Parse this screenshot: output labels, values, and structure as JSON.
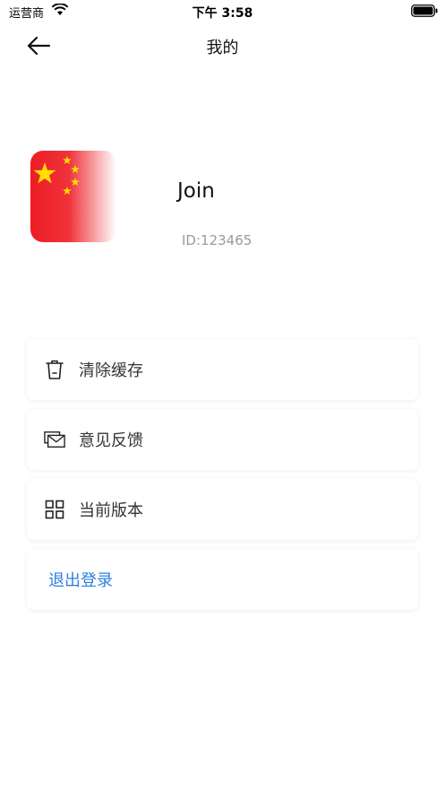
{
  "status_bar": {
    "carrier": "运营商",
    "time": "下午 3:58"
  },
  "nav": {
    "title": "我的"
  },
  "profile": {
    "username": "Join",
    "user_id": "ID:123465"
  },
  "menu": {
    "items": [
      {
        "label": "清除缓存",
        "icon": "trash-icon"
      },
      {
        "label": "意见反馈",
        "icon": "mail-icon"
      },
      {
        "label": "当前版本",
        "icon": "grid-icon"
      }
    ],
    "logout_label": "退出登录"
  },
  "colors": {
    "accent": "#2f7fe0",
    "flag_red": "#ee1c25",
    "flag_star": "#ffde00"
  }
}
